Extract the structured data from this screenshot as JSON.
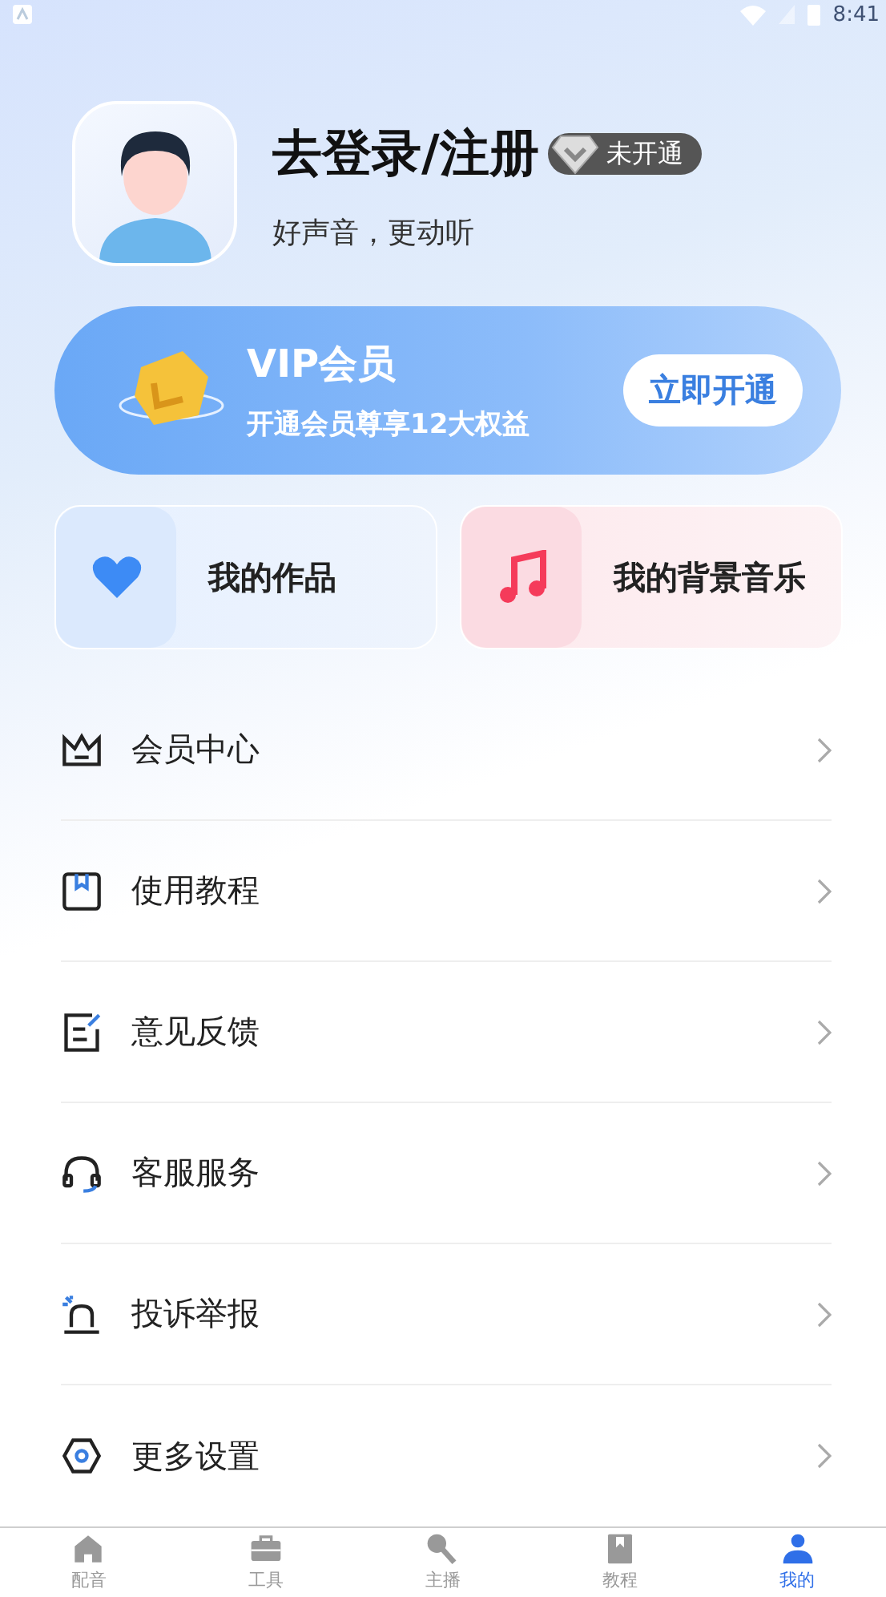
{
  "status_bar": {
    "time": "8:41"
  },
  "profile": {
    "title": "去登录/注册",
    "badge": "未开通",
    "badge_active": false,
    "subtitle": "好声音，更动听"
  },
  "vip_card": {
    "title": "VIP会员",
    "subtitle": "开通会员尊享12大权益",
    "button": "立即开通"
  },
  "tiles": [
    {
      "kind": "works",
      "label": "我的作品"
    },
    {
      "kind": "music",
      "label": "我的背景音乐"
    }
  ],
  "menu": [
    {
      "kind": "crown",
      "label": "会员中心"
    },
    {
      "kind": "book",
      "label": "使用教程"
    },
    {
      "kind": "feedback",
      "label": "意见反馈"
    },
    {
      "kind": "headset",
      "label": "客服服务"
    },
    {
      "kind": "alarm",
      "label": "投诉举报"
    },
    {
      "kind": "settings",
      "label": "更多设置"
    }
  ],
  "bottom_nav": [
    {
      "kind": "home",
      "label": "配音",
      "selected": false
    },
    {
      "kind": "toolbox",
      "label": "工具",
      "selected": false
    },
    {
      "kind": "mic",
      "label": "主播",
      "selected": false
    },
    {
      "kind": "bookmark",
      "label": "教程",
      "selected": false
    },
    {
      "kind": "person",
      "label": "我的",
      "selected": true
    }
  ]
}
